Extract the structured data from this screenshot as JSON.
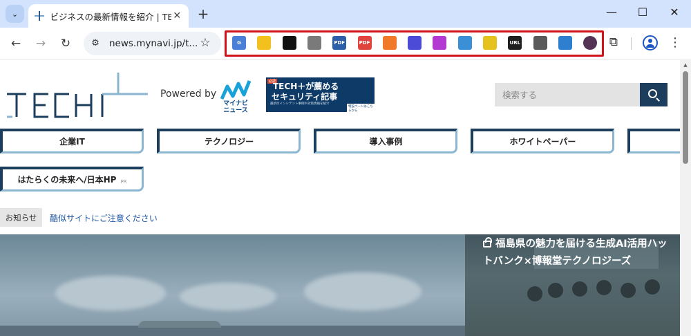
{
  "browser": {
    "tab_title": "ビジネスの最新情報を紹介 | TECH+",
    "url": "news.mynavi.jp/t...",
    "extensions": [
      {
        "name": "google-translate-icon",
        "color": "#4a7fd8",
        "label": "G"
      },
      {
        "name": "lightbulb-icon",
        "color": "#f3c11d",
        "label": ""
      },
      {
        "name": "qr-square-icon",
        "color": "#111111",
        "label": ""
      },
      {
        "name": "camera-icon",
        "color": "#7a7a7a",
        "label": ""
      },
      {
        "name": "pdf-icon",
        "color": "#2b5fa8",
        "label": "PDF"
      },
      {
        "name": "pdf-red-icon",
        "color": "#e0453d",
        "label": "PDF"
      },
      {
        "name": "megaphone-icon",
        "color": "#f07a2a",
        "label": ""
      },
      {
        "name": "audio-wave-icon",
        "color": "#4b4bd8",
        "label": ""
      },
      {
        "name": "download-icon",
        "color": "#b23ad1",
        "label": ""
      },
      {
        "name": "phone-icon",
        "color": "#3b8fd6",
        "label": ""
      },
      {
        "name": "yellow-lens-icon",
        "color": "#e5c21d",
        "label": ""
      },
      {
        "name": "url-icon",
        "color": "#1f1f1f",
        "label": "URL"
      },
      {
        "name": "highlighter-icon",
        "color": "#5a5a5a",
        "label": ""
      },
      {
        "name": "marker-icon",
        "color": "#2f7fd0",
        "label": ""
      },
      {
        "name": "avatar-circle-icon",
        "color": "#553355",
        "label": ""
      }
    ]
  },
  "header": {
    "powered_by": "Powered by",
    "mynavi_text": "マイナビ ニュース",
    "banner_line1": "TECH＋が薦める",
    "banner_line2": "セキュリティ記事",
    "banner_tag": "必読",
    "banner_small": "最新のインシデント事例や対策情報を紹介",
    "banner_cta": "特設ページはこちらから",
    "search_placeholder": "検索する"
  },
  "nav": {
    "items": [
      "企業IT",
      "テクノロジー",
      "導入事例",
      "ホワイトペーパー"
    ],
    "pr_item": "はたらくの未来へ/日本HP",
    "pr_label": "PR"
  },
  "notice": {
    "label": "お知らせ",
    "link": "酷似サイトにご注意ください"
  },
  "hero": {
    "title_line1": "福島県の魅力を届ける生成AI活用ハッ",
    "title_line2": "トバンク×博報堂テクノロジーズ"
  }
}
